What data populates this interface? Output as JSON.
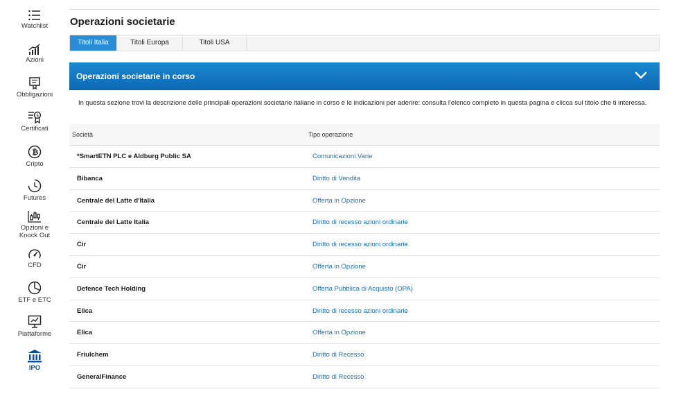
{
  "sidebar": {
    "items": [
      {
        "label": "Watchlist",
        "icon": "list-icon"
      },
      {
        "label": "Azioni",
        "icon": "chart-up-icon"
      },
      {
        "label": "Obbligazioni",
        "icon": "bond-icon"
      },
      {
        "label": "Certificati",
        "icon": "certificate-icon"
      },
      {
        "label": "Cripto",
        "icon": "bitcoin-icon"
      },
      {
        "label": "Futures",
        "icon": "clock-icon"
      },
      {
        "label": "Opzioni e",
        "label2": "Knock Out",
        "icon": "candlestick-icon"
      },
      {
        "label": "CFD",
        "icon": "gauge-icon"
      },
      {
        "label": "ETF e ETC",
        "icon": "pie-chart-icon"
      },
      {
        "label": "Piattaforme",
        "icon": "monitor-chart-icon"
      },
      {
        "label": "IPO",
        "icon": "bank-icon",
        "active": true
      }
    ]
  },
  "page": {
    "title": "Operazioni societarie"
  },
  "tabs": [
    {
      "label": "Titoli Italia",
      "active": true
    },
    {
      "label": "Titoli Europa"
    },
    {
      "label": "Titoli USA"
    }
  ],
  "banner": {
    "title": "Operazioni societarie in corso"
  },
  "intro": "In questa sezione trovi la descrizione delle principali operazioni societarie italiane in corso e le indicazioni per aderire: consulta l'elenco completo in questa pagina e clicca sul titolo che ti interessa.",
  "table": {
    "headers": {
      "company": "Società",
      "operation": "Tipo operazione"
    },
    "rows": [
      {
        "company": "*SmartETN PLC e Aldburg Public SA",
        "operation": "Comunicazioni Varie"
      },
      {
        "company": "Bibanca",
        "operation": "Diritto di Vendita"
      },
      {
        "company": "Centrale del Latte d'Italia",
        "operation": "Offerta in Opzione"
      },
      {
        "company": "Centrale del Latte Italia",
        "operation": "Diritto di recesso azioni ordinarie"
      },
      {
        "company": "Cir",
        "operation": "Diritto di recesso azioni ordinarie"
      },
      {
        "company": "Cir",
        "operation": "Offerta in Opzione"
      },
      {
        "company": "Defence Tech Holding",
        "operation": "Offerta Pubblica di Acquisto (OPA)"
      },
      {
        "company": "Elica",
        "operation": "Diritto di recesso azioni ordinarie"
      },
      {
        "company": "Elica",
        "operation": "Offerta in Opzione"
      },
      {
        "company": "Friulchem",
        "operation": "Diritto di Recesso"
      },
      {
        "company": "GeneralFinance",
        "operation": "Diritto di Recesso"
      }
    ]
  },
  "colors": {
    "accent": "#0d6ab5",
    "tab_active": "#2a8dd8",
    "link": "#1a6fb4",
    "nav_active": "#0b4fa0"
  }
}
